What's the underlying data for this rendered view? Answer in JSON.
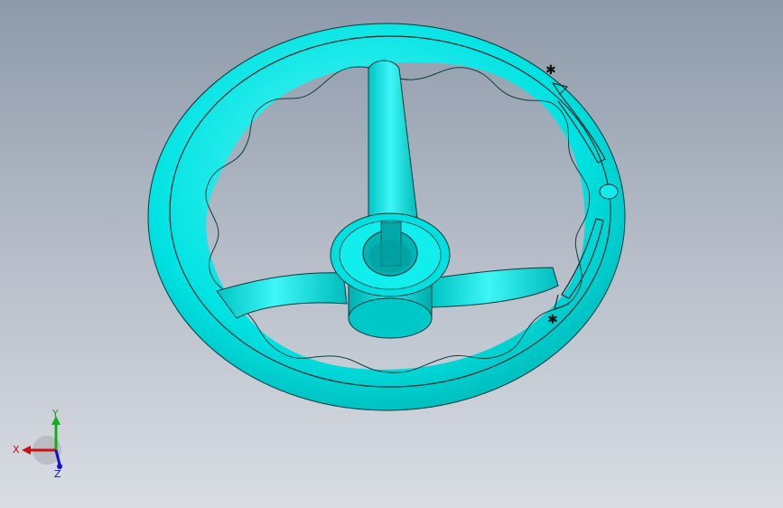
{
  "viewport": {
    "background_top": "#8e9aaa",
    "background_bottom": "#d9dde3"
  },
  "model": {
    "part": "handwheel",
    "color": "#00e5e5",
    "shadow_color": "#00b8b8",
    "edge_color": "#1a2a2a",
    "markings": [
      "open-arrow-icon",
      "close-arrow-icon",
      "bead-icon"
    ]
  },
  "triad": {
    "x_label": "X",
    "y_label": "Y",
    "z_label": "Z",
    "x_color": "#d01010",
    "y_color": "#10b010",
    "z_color": "#1010d0"
  }
}
